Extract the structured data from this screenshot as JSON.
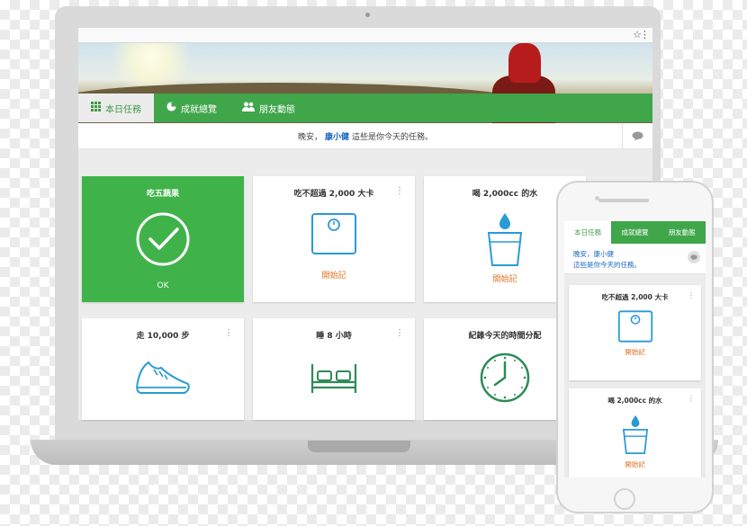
{
  "browser": {
    "star_icon": "☆",
    "menu_icon": "⋮"
  },
  "tabs": [
    {
      "label": "本日任務",
      "icon": "grid-icon"
    },
    {
      "label": "成就總覽",
      "icon": "pie-chart-icon"
    },
    {
      "label": "朋友動態",
      "icon": "people-icon"
    }
  ],
  "greeting": {
    "prefix": "晚安，",
    "name": "康小健",
    "suffix": " 這些是你今天的任務。"
  },
  "tasks": [
    {
      "title": "吃五蔬果",
      "action": "OK",
      "status": "done",
      "icon": "checkmark-circle-icon"
    },
    {
      "title": "吃不超過 2,000 大卡",
      "action": "開始記",
      "icon": "scale-icon"
    },
    {
      "title": "喝 2,000cc 的水",
      "action": "開始記",
      "icon": "water-glass-icon"
    },
    {
      "title": "走 10,000 步",
      "icon": "sneaker-icon"
    },
    {
      "title": "睡 8 小時",
      "icon": "bed-icon"
    },
    {
      "title": "紀錄今天的時間分配",
      "icon": "clock-icon"
    }
  ],
  "phone": {
    "tabs": [
      "本日任務",
      "成就總覽",
      "朋友動態"
    ],
    "greeting_line1": "晚安，康小健",
    "greeting_line2": "這些是你今天的任務。",
    "cards": [
      {
        "title": "吃不超過 2,000 大卡",
        "action": "開始記",
        "icon": "scale-icon"
      },
      {
        "title": "喝 2,000cc 的水",
        "action": "開始記",
        "icon": "water-glass-icon"
      }
    ]
  },
  "colors": {
    "brand_green": "#3fa64a",
    "action_orange": "#e07020",
    "icon_blue": "#2a9ad6",
    "icon_green": "#2e8b57"
  }
}
